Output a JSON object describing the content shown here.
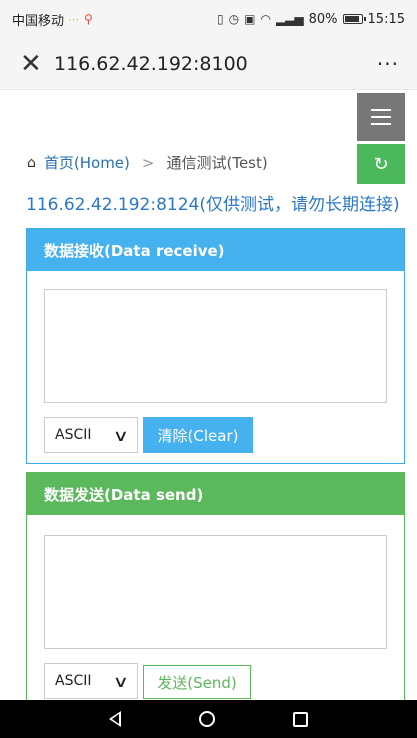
{
  "status_bar": {
    "carrier": "中国移动",
    "battery_text": "80%",
    "time": "15:15",
    "icons": [
      "nfc-icon",
      "alarm-icon",
      "hd-icon",
      "wifi-icon",
      "signal-icon",
      "battery-icon"
    ]
  },
  "browser": {
    "close_glyph": "✕",
    "url": "116.62.42.192:8100",
    "more_glyph": "···"
  },
  "breadcrumb": {
    "home": "首页(Home)",
    "separator": ">",
    "current": "通信测试(Test)"
  },
  "notice": "116.62.42.192:8124(仅供测试，请勿长期连接)",
  "receive_panel": {
    "title": "数据接收(Data receive)",
    "textarea_value": "",
    "encoding": "ASCII",
    "clear_label": "清除(Clear)"
  },
  "send_panel": {
    "title": "数据发送(Data send)",
    "textarea_value": "",
    "encoding": "ASCII",
    "send_label": "发送(Send)"
  },
  "colors": {
    "receive_accent": "#45b1ef",
    "send_accent": "#5cb85c",
    "link": "#2a6fb0",
    "menu_button": "#777777"
  }
}
